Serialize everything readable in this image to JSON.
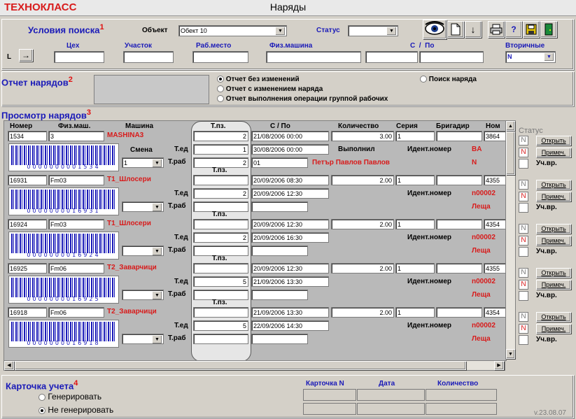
{
  "title": {
    "brand": "ТЕХНОКЛАСС",
    "window": "Наряды"
  },
  "search": {
    "heading": "Условия поиска",
    "num": "1",
    "object_label": "Объект",
    "object_value": "Обект 10",
    "status_label": "Статус",
    "status_value": "",
    "l_label": "L",
    "arrow": "→",
    "cols": {
      "ceh": "Цех",
      "uchastok": "Участок",
      "rabmesto": "Раб.место",
      "fizmashina": "Физ.машина",
      "s": "С",
      "slash": "/",
      "po": "По",
      "vtorichnye": "Вторичные"
    },
    "vtorichnye_value": "N"
  },
  "report": {
    "heading": "Отчет нарядов",
    "num": "2",
    "opt1": "Отчет без изменений",
    "opt2": "Отчет с изменением наряда",
    "opt3": "Отчет выполнения операции группой рабочих",
    "opt4": "Поиск наряда"
  },
  "view": {
    "heading": "Просмотр нарядов",
    "num": "3",
    "headers": {
      "nomer": "Номер",
      "fizmash": "Физ.маш.",
      "mashina": "Машина",
      "tpz": "Т.пз.",
      "spo": "С / По",
      "kolichestvo": "Количество",
      "seriya": "Серия",
      "brigadir": "Бригадир",
      "nom": "Ном"
    },
    "lbl_smena": "Смена",
    "lbl_ted": "Т.ед",
    "lbl_trab": "Т.раб",
    "lbl_tpz": "Т.пз.",
    "lbl_vypolnil": "Выполнил",
    "lbl_ident": "Идент.номер",
    "rows": [
      {
        "nomer": "1534",
        "fizmash": "3",
        "mashina": "MASHINA3",
        "tpz": "2",
        "ted": "1",
        "trab": "2",
        "s": "21/08/2006 00:00",
        "po": "30/08/2006 00:00",
        "kol": "3.00",
        "seriya": "1",
        "nom": "3864",
        "barcode": "0000000001534",
        "smena": "1",
        "rab_text": "01",
        "worker": "Петър Павлов Павлов",
        "ident": "BA",
        "extra": "N",
        "status": "N",
        "btn_open": "Открыть",
        "btn_note": "Примеч.",
        "chk": "Уч.вр."
      },
      {
        "nomer": "16931",
        "fizmash": "Fm03",
        "mashina": "T1_Шлосери",
        "tpz": "",
        "ted": "2",
        "trab": "",
        "s": "20/09/2006 08:30",
        "po": "20/09/2006 12:30",
        "kol": "2.00",
        "seriya": "1",
        "nom": "4355",
        "barcode": "0000000016931",
        "smena": "",
        "rab_text": "",
        "worker": "",
        "ident": "n00002",
        "extra": "Леща",
        "status": "N",
        "btn_open": "Открыть",
        "btn_note": "Примеч.",
        "chk": "Уч.вр."
      },
      {
        "nomer": "16924",
        "fizmash": "Fm03",
        "mashina": "T1_Шлосери",
        "tpz": "",
        "ted": "2",
        "trab": "",
        "s": "20/09/2006 12:30",
        "po": "20/09/2006 16:30",
        "kol": "2.00",
        "seriya": "1",
        "nom": "4354",
        "barcode": "0000000016924",
        "smena": "",
        "rab_text": "",
        "worker": "",
        "ident": "n00002",
        "extra": "Леща",
        "status": "N",
        "btn_open": "Открыть",
        "btn_note": "Примеч.",
        "chk": "Уч.вр."
      },
      {
        "nomer": "16925",
        "fizmash": "Fm06",
        "mashina": "T2_Заварчици",
        "tpz": "",
        "ted": "5",
        "trab": "",
        "s": "20/09/2006 12:30",
        "po": "21/09/2006 13:30",
        "kol": "2.00",
        "seriya": "1",
        "nom": "4355",
        "barcode": "0000000016925",
        "smena": "",
        "rab_text": "",
        "worker": "",
        "ident": "n00002",
        "extra": "Леща",
        "status": "N",
        "btn_open": "Открыть",
        "btn_note": "Примеч.",
        "chk": "Уч.вр."
      },
      {
        "nomer": "16918",
        "fizmash": "Fm06",
        "mashina": "T2_Заварчици",
        "tpz": "",
        "ted": "5",
        "trab": "",
        "s": "21/09/2006 13:30",
        "po": "22/09/2006 14:30",
        "kol": "2.00",
        "seriya": "1",
        "nom": "4354",
        "barcode": "0000000016918",
        "smena": "",
        "rab_text": "",
        "worker": "",
        "ident": "n00002",
        "extra": "Леща",
        "status": "N",
        "btn_open": "Открыть",
        "btn_note": "Примеч.",
        "chk": "Уч.вр."
      }
    ],
    "status_label": "Статус"
  },
  "card": {
    "heading": "Карточка учета",
    "num": "4",
    "opt1": "Генерировать",
    "opt2": "Не генерировать",
    "col1": "Карточка N",
    "col2": "Дата",
    "col3": "Количество"
  },
  "version": "v.23.08.07"
}
